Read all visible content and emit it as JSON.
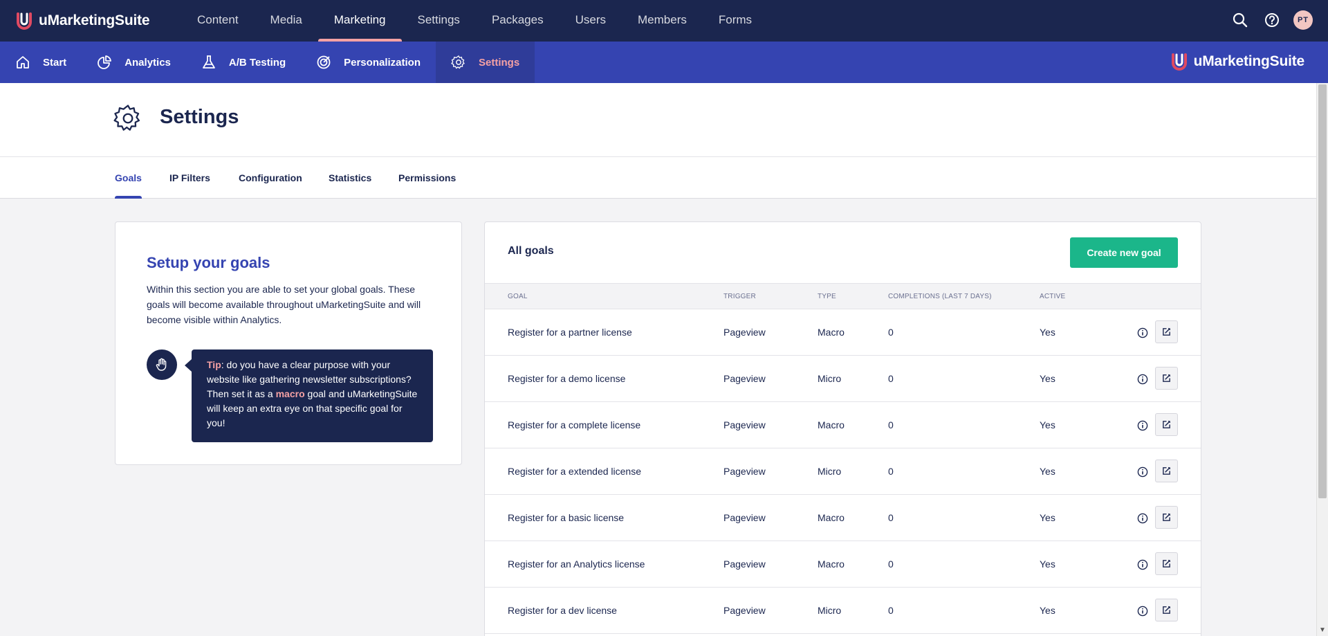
{
  "app": {
    "brand_name": "uMarketingSuite",
    "sub_brand_name": "uMarketingSuite"
  },
  "top_nav": [
    {
      "label": "Content",
      "active": false
    },
    {
      "label": "Media",
      "active": false
    },
    {
      "label": "Marketing",
      "active": true
    },
    {
      "label": "Settings",
      "active": false
    },
    {
      "label": "Packages",
      "active": false
    },
    {
      "label": "Users",
      "active": false
    },
    {
      "label": "Members",
      "active": false
    },
    {
      "label": "Forms",
      "active": false
    }
  ],
  "user": {
    "initials": "PT"
  },
  "sub_nav": [
    {
      "label": "Start",
      "icon": "home-icon",
      "active": false
    },
    {
      "label": "Analytics",
      "icon": "pie-chart-icon",
      "active": false
    },
    {
      "label": "A/B Testing",
      "icon": "flask-icon",
      "active": false
    },
    {
      "label": "Personalization",
      "icon": "target-icon",
      "active": false
    },
    {
      "label": "Settings",
      "icon": "gear-icon",
      "active": true
    }
  ],
  "page": {
    "title": "Settings"
  },
  "tabs": [
    {
      "label": "Goals",
      "active": true
    },
    {
      "label": "IP Filters",
      "active": false
    },
    {
      "label": "Configuration",
      "active": false
    },
    {
      "label": "Statistics",
      "active": false
    },
    {
      "label": "Permissions",
      "active": false
    }
  ],
  "info": {
    "title": "Setup your goals",
    "text": "Within this section you are able to set your global goals. These goals will become available throughout uMarketingSuite and will become visible within Analytics.",
    "tip_label": "Tip",
    "tip_part1": ": do you have a clear purpose with your website like gathering newsletter subscriptions? Then set it as a ",
    "tip_highlight": "macro",
    "tip_part2": " goal and uMarketingSuite will keep an extra eye on that specific goal for you!"
  },
  "goals": {
    "title": "All goals",
    "create_label": "Create new goal",
    "columns": {
      "goal": "Goal",
      "trigger": "Trigger",
      "type": "Type",
      "completions": "Completions (last 7 days)",
      "active": "Active"
    },
    "rows": [
      {
        "goal": "Register for a partner license",
        "trigger": "Pageview",
        "type": "Macro",
        "completions": "0",
        "active": "Yes"
      },
      {
        "goal": "Register for a demo license",
        "trigger": "Pageview",
        "type": "Micro",
        "completions": "0",
        "active": "Yes"
      },
      {
        "goal": "Register for a complete license",
        "trigger": "Pageview",
        "type": "Macro",
        "completions": "0",
        "active": "Yes"
      },
      {
        "goal": "Register for a extended license",
        "trigger": "Pageview",
        "type": "Micro",
        "completions": "0",
        "active": "Yes"
      },
      {
        "goal": "Register for a basic license",
        "trigger": "Pageview",
        "type": "Macro",
        "completions": "0",
        "active": "Yes"
      },
      {
        "goal": "Register for an Analytics license",
        "trigger": "Pageview",
        "type": "Macro",
        "completions": "0",
        "active": "Yes"
      },
      {
        "goal": "Register for a dev license",
        "trigger": "Pageview",
        "type": "Micro",
        "completions": "0",
        "active": "Yes"
      }
    ]
  },
  "colors": {
    "topbar": "#1b264f",
    "subbar": "#3544b1",
    "accent_pink": "#f5a1a4",
    "create_button": "#1bb68a"
  }
}
